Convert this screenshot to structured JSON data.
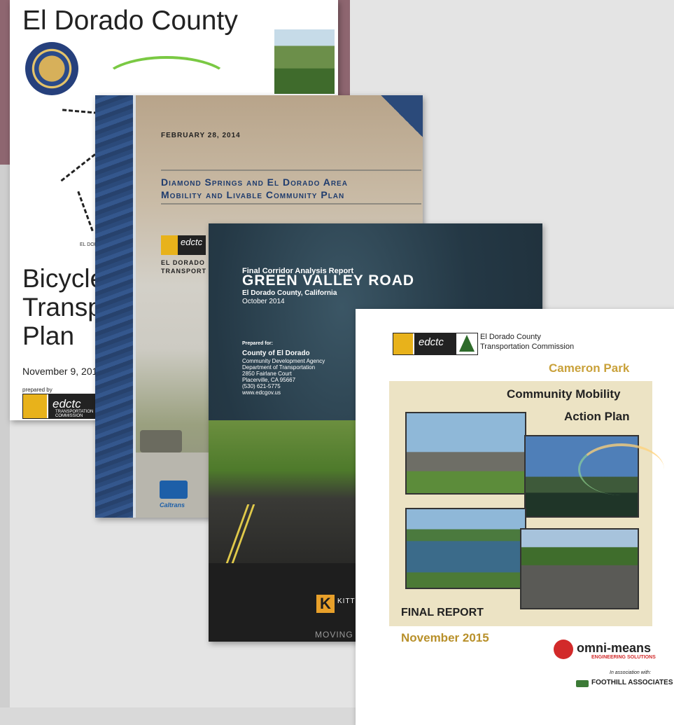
{
  "covers": {
    "bicycle": {
      "county_title": "El Dorado County",
      "title_lines": [
        "Bicycle",
        "Transp",
        "Plan"
      ],
      "date": "November 9, 201",
      "prepared_by": "prepared by",
      "logo_word": "edctc",
      "logo_sub": "TRANSPORTATION COMMISSION",
      "map_label": "EL DORADO"
    },
    "diamond_springs": {
      "date": "FEBRUARY 28, 2014",
      "title_line1": "Diamond Springs and El Dorado Area",
      "title_line2": "Mobility and Livable Community Plan",
      "logo_word": "edctc",
      "org_line1": "EL DORADO",
      "org_line2": "TRANSPORT",
      "caltrans_label": "Caltrans"
    },
    "green_valley": {
      "kicker": "Final Corridor Analysis Report",
      "title": "GREEN VALLEY ROAD",
      "location": "El Dorado County, California",
      "date": "October 2014",
      "prepared_for": "Prepared for:",
      "county": "County of El Dorado",
      "address_lines": [
        "Community Development Agency",
        "Department of Transportation",
        "2850 Fairlane Court",
        "Placerville, CA 95667",
        "(530) 621-5775",
        "www.edcgov.us"
      ],
      "k_letter": "K",
      "k_word": "KITTE",
      "moving": "MOVING"
    },
    "cameron_park": {
      "logo_word": "edctc",
      "org_line1": "El Dorado County",
      "org_line2": "Transportation Commission",
      "place": "Cameron Park",
      "title_line1": "Community Mobility",
      "title_line2": "Action Plan",
      "final": "FINAL REPORT",
      "date": "November 2015",
      "consultant": "omni-means",
      "consultant_sub": "ENGINEERING SOLUTIONS",
      "association": "In association with:",
      "associate": "FOOTHILL ASSOCIATES"
    }
  }
}
